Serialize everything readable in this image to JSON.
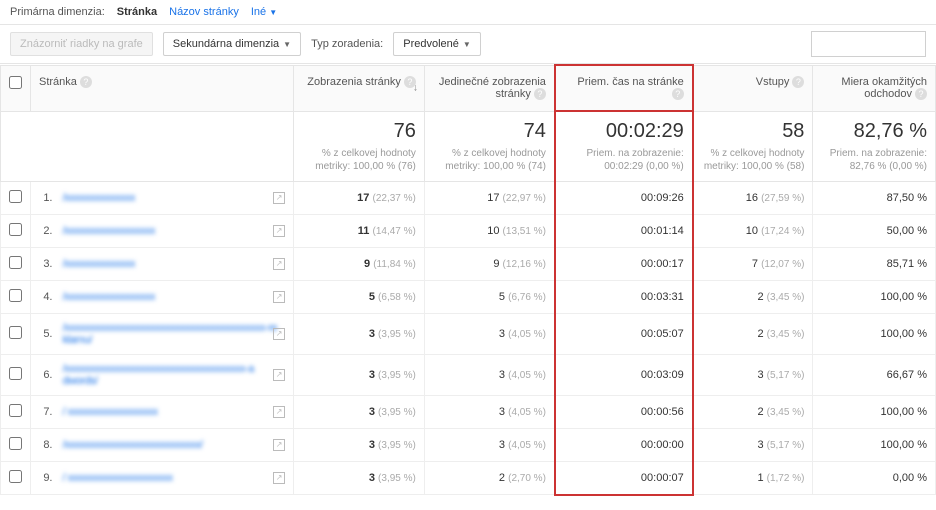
{
  "dimbar": {
    "label": "Primárna dimenzia:",
    "active": "Stránka",
    "link1": "Názov stránky",
    "link2": "Iné"
  },
  "ctrl": {
    "graph": "Znázorniť riadky na grafe",
    "secondary": "Sekundárna dimenzia",
    "sortlbl": "Typ zoradenia:",
    "sortval": "Predvolené",
    "search_ph": ""
  },
  "headers": {
    "chk": "",
    "page": "Stránka",
    "views": "Zobrazenia stránky",
    "unique": "Jedinečné zobrazenia stránky",
    "avgtime": "Priem. čas na stránke",
    "entries": "Vstupy",
    "bounce": "Miera okamžitých odchodov"
  },
  "summary": {
    "views": {
      "big": "76",
      "sub": "% z celkovej hodnoty metriky: 100,00 % (76)"
    },
    "unique": {
      "big": "74",
      "sub": "% z celkovej hodnoty metriky: 100,00 % (74)"
    },
    "avgtime": {
      "big": "00:02:29",
      "sub": "Priem. na zobrazenie: 00:02:29 (0,00 %)"
    },
    "entries": {
      "big": "58",
      "sub": "% z celkovej hodnoty metriky: 100,00 % (58)"
    },
    "bounce": {
      "big": "82,76 %",
      "sub": "Priem. na zobrazenie: 82,76 % (0,00 %)"
    }
  },
  "rows": [
    {
      "n": "1.",
      "page": "/xxxxxxxxxxxxxx",
      "v": "17",
      "vp": "(22,37 %)",
      "u": "17",
      "up": "(22,97 %)",
      "t": "00:09:26",
      "e": "16",
      "ep": "(27,59 %)",
      "b": "87,50 %"
    },
    {
      "n": "2.",
      "page": "/xxxxxxxxxxxxxxxxxx",
      "v": "11",
      "vp": "(14,47 %)",
      "u": "10",
      "up": "(13,51 %)",
      "t": "00:01:14",
      "e": "10",
      "ep": "(17,24 %)",
      "b": "50,00 %"
    },
    {
      "n": "3.",
      "page": "/xxxxxxxxxxxxxx",
      "v": "9",
      "vp": "(11,84 %)",
      "u": "9",
      "up": "(12,16 %)",
      "t": "00:00:17",
      "e": "7",
      "ep": "(12,07 %)",
      "b": "85,71 %"
    },
    {
      "n": "4.",
      "page": "/xxxxxxxxxxxxxxxxxx",
      "v": "5",
      "vp": "(6,58 %)",
      "u": "5",
      "up": "(6,76 %)",
      "t": "00:03:31",
      "e": "2",
      "ep": "(3,45 %)",
      "b": "100,00 %"
    },
    {
      "n": "5.",
      "page": "/xxxxxxxxxxxxxxxxxxxxxxxxxxxxxxxxxxxxxxxx-re klamu/",
      "v": "3",
      "vp": "(3,95 %)",
      "u": "3",
      "up": "(4,05 %)",
      "t": "00:05:07",
      "e": "2",
      "ep": "(3,45 %)",
      "b": "100,00 %"
    },
    {
      "n": "6.",
      "page": "/xxxxxxxxxxxxxxxxxxxxxxxxxxxxxxxxxxxx-a dwords/",
      "v": "3",
      "vp": "(3,95 %)",
      "u": "3",
      "up": "(4,05 %)",
      "t": "00:03:09",
      "e": "3",
      "ep": "(5,17 %)",
      "b": "66,67 %"
    },
    {
      "n": "7.",
      "page": "/ xxxxxxxxxxxxxxxxxx",
      "v": "3",
      "vp": "(3,95 %)",
      "u": "3",
      "up": "(4,05 %)",
      "t": "00:00:56",
      "e": "2",
      "ep": "(3,45 %)",
      "b": "100,00 %"
    },
    {
      "n": "8.",
      "page": "/xxxxxxxxxxxxxxxxxxxxxxxxxxx/",
      "v": "3",
      "vp": "(3,95 %)",
      "u": "3",
      "up": "(4,05 %)",
      "t": "00:00:00",
      "e": "3",
      "ep": "(5,17 %)",
      "b": "100,00 %"
    },
    {
      "n": "9.",
      "page": "/ xxxxxxxxxxxxxxxxxxxxx",
      "v": "3",
      "vp": "(3,95 %)",
      "u": "2",
      "up": "(2,70 %)",
      "t": "00:00:07",
      "e": "1",
      "ep": "(1,72 %)",
      "b": "0,00 %"
    }
  ]
}
